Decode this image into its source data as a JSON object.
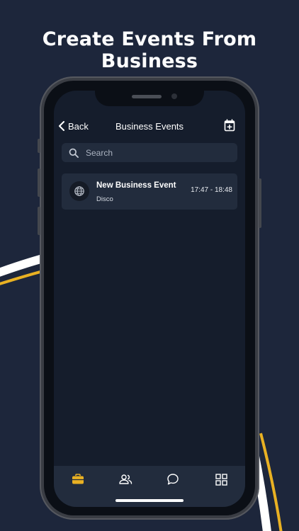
{
  "headline": "Create Events From Business",
  "nav": {
    "back_label": "Back",
    "title": "Business Events"
  },
  "search": {
    "placeholder": "Search",
    "value": ""
  },
  "events": [
    {
      "name": "New Business Event",
      "category": "Disco",
      "time": "17:47 - 18:48"
    }
  ],
  "tabs": [
    {
      "icon": "briefcase-icon",
      "active": true
    },
    {
      "icon": "people-icon",
      "active": false
    },
    {
      "icon": "chat-icon",
      "active": false
    },
    {
      "icon": "grid-icon",
      "active": false
    }
  ],
  "colors": {
    "background": "#1d263b",
    "screen": "#151d2c",
    "card": "#222c3d",
    "accent": "#e9b123",
    "stripe": "#ffffff"
  }
}
